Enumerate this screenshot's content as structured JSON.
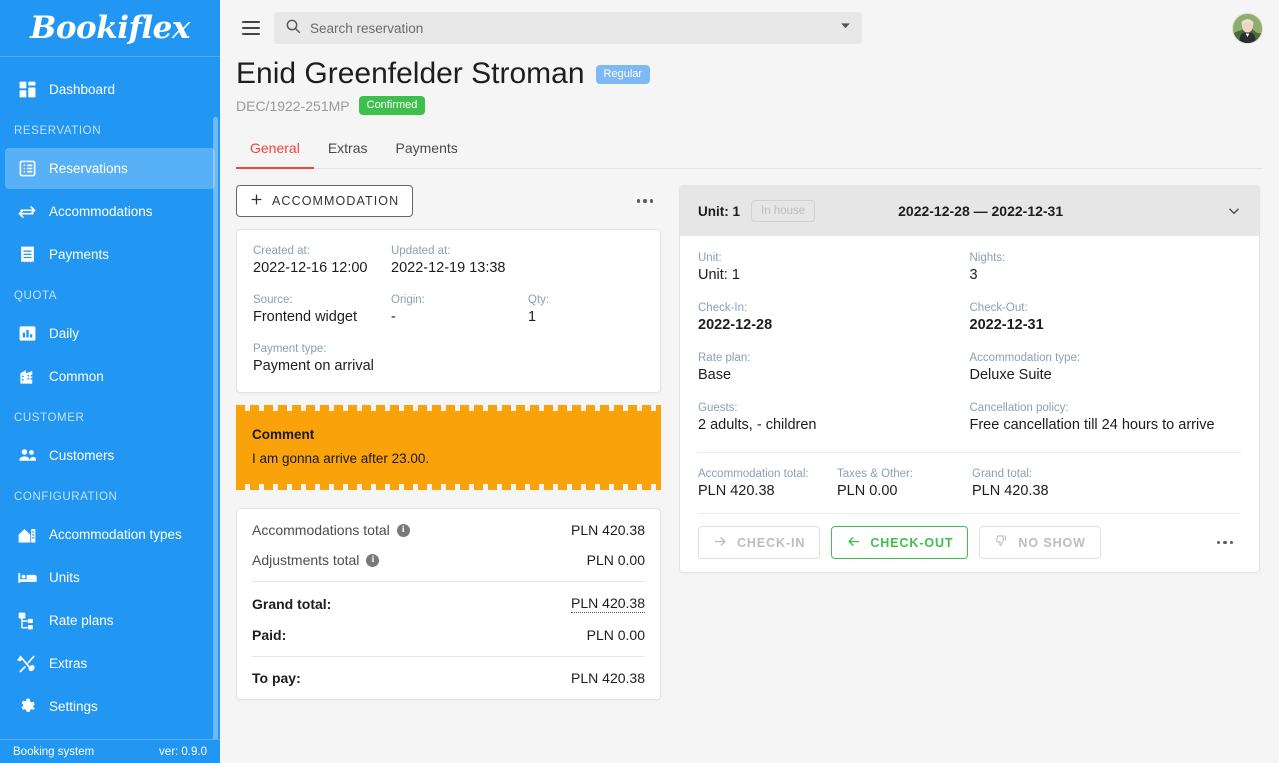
{
  "brand": {
    "name": "Bookiflex"
  },
  "sidebar": {
    "items": [
      {
        "type": "item",
        "label": "Dashboard",
        "icon": "dashboard-icon",
        "active": false
      },
      {
        "type": "section",
        "label": "RESERVATION"
      },
      {
        "type": "item",
        "label": "Reservations",
        "icon": "list-icon",
        "active": true
      },
      {
        "type": "item",
        "label": "Accommodations",
        "icon": "swap-icon",
        "active": false
      },
      {
        "type": "item",
        "label": "Payments",
        "icon": "receipt-icon",
        "active": false
      },
      {
        "type": "section",
        "label": "QUOTA"
      },
      {
        "type": "item",
        "label": "Daily",
        "icon": "bar-chart-icon",
        "active": false
      },
      {
        "type": "item",
        "label": "Common",
        "icon": "building-icon",
        "active": false
      },
      {
        "type": "section",
        "label": "CUSTOMER"
      },
      {
        "type": "item",
        "label": "Customers",
        "icon": "people-icon",
        "active": false
      },
      {
        "type": "section",
        "label": "CONFIGURATION"
      },
      {
        "type": "item",
        "label": "Accommodation types",
        "icon": "home-icon",
        "active": false
      },
      {
        "type": "item",
        "label": "Units",
        "icon": "bed-icon",
        "active": false
      },
      {
        "type": "item",
        "label": "Rate plans",
        "icon": "hierarchy-icon",
        "active": false
      },
      {
        "type": "item",
        "label": "Extras",
        "icon": "cutlery-icon",
        "active": false
      },
      {
        "type": "item",
        "label": "Settings",
        "icon": "gear-icon",
        "active": false
      }
    ],
    "footer": {
      "product": "Booking system",
      "version": "ver: 0.9.0"
    }
  },
  "topbar": {
    "search": {
      "placeholder": "Search reservation",
      "value": ""
    },
    "menu_icon": "hamburger-icon",
    "search_icon": "search-icon",
    "dropdown_icon": "chevron-down-icon",
    "avatar": "user-avatar"
  },
  "header": {
    "title": "Enid Greenfelder Stroman",
    "customer_badge": "Regular",
    "reservation_code": "DEC/1922-251MP",
    "status_badge": "Confirmed",
    "tabs": [
      {
        "label": "General",
        "active": true
      },
      {
        "label": "Extras",
        "active": false
      },
      {
        "label": "Payments",
        "active": false
      }
    ]
  },
  "left": {
    "add_button": "ACCOMMODATION",
    "add_icon": "plus-icon",
    "kebab_icon": "more-horizontal-icon",
    "details": {
      "created_at_label": "Created at:",
      "created_at_value": "2022-12-16 12:00",
      "updated_at_label": "Updated at:",
      "updated_at_value": "2022-12-19 13:38",
      "source_label": "Source:",
      "source_value": "Frontend widget",
      "origin_label": "Origin:",
      "origin_value": "-",
      "qty_label": "Qty:",
      "qty_value": "1",
      "payment_type_label": "Payment type:",
      "payment_type_value": "Payment on arrival"
    },
    "comment": {
      "title": "Comment",
      "text": "I am gonna arrive after 23.00."
    },
    "totals": {
      "accommodations_label": "Accommodations total",
      "accommodations_value": "PLN 420.38",
      "adjustments_label": "Adjustments total",
      "adjustments_value": "PLN 0.00",
      "grand_total_label": "Grand total:",
      "grand_total_value": "PLN 420.38",
      "paid_label": "Paid:",
      "paid_value": "PLN 0.00",
      "to_pay_label": "To pay:",
      "to_pay_value": "PLN 420.38",
      "info_icon": "info-icon"
    }
  },
  "right": {
    "head": {
      "unit_title": "Unit: 1",
      "status_badge": "In house",
      "date_range": "2022-12-28 — 2022-12-31",
      "collapse_icon": "chevron-down-icon"
    },
    "fields": {
      "unit_label": "Unit:",
      "unit_value": "Unit: 1",
      "nights_label": "Nights:",
      "nights_value": "3",
      "checkin_label": "Check-In:",
      "checkin_value": "2022-12-28",
      "checkout_label": "Check-Out:",
      "checkout_value": "2022-12-31",
      "rate_plan_label": "Rate plan:",
      "rate_plan_value": "Base",
      "accommodation_type_label": "Accommodation type:",
      "accommodation_type_value": "Deluxe Suite",
      "guests_label": "Guests:",
      "guests_value": "2 adults, - children",
      "cancellation_label": "Cancellation policy:",
      "cancellation_value": "Free cancellation till 24 hours to arrive"
    },
    "money": {
      "accommodation_total_label": "Accommodation total:",
      "accommodation_total_value": "PLN 420.38",
      "taxes_label": "Taxes & Other:",
      "taxes_value": "PLN 0.00",
      "grand_total_label": "Grand total:",
      "grand_total_value": "PLN 420.38"
    },
    "actions": {
      "checkin_label": "CHECK-IN",
      "checkin_icon": "arrow-right-icon",
      "checkout_label": "CHECK-OUT",
      "checkout_icon": "arrow-left-icon",
      "noshow_label": "NO SHOW",
      "noshow_icon": "thumb-down-icon",
      "kebab_icon": "more-horizontal-icon"
    }
  },
  "colors": {
    "brand_blue": "#2196f3",
    "accent_red": "#f4433a",
    "green": "#3fbf4e",
    "orange": "#f9a20a",
    "badge_blue": "#7cb9f5",
    "label_blue_gray": "#8ba0b5"
  }
}
